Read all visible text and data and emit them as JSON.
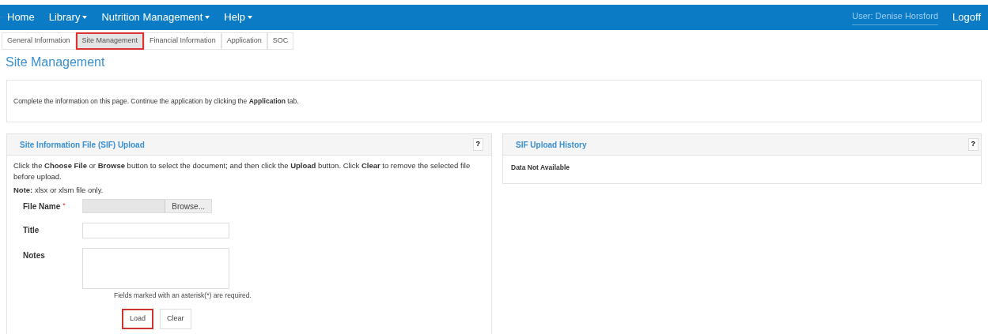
{
  "navbar": {
    "items": [
      {
        "label": "Home",
        "dropdown": false
      },
      {
        "label": "Library",
        "dropdown": true
      },
      {
        "label": "Nutrition Management",
        "dropdown": true
      },
      {
        "label": "Help",
        "dropdown": true
      }
    ],
    "user": "User: Denise Horsford",
    "logoff": "Logoff"
  },
  "tabs": [
    {
      "label": "General Information",
      "selected": false,
      "highlighted": false
    },
    {
      "label": "Site Management",
      "selected": true,
      "highlighted": true
    },
    {
      "label": "Financial Information",
      "selected": false,
      "highlighted": false
    },
    {
      "label": "Application",
      "selected": false,
      "highlighted": false
    },
    {
      "label": "SOC",
      "selected": false,
      "highlighted": false
    }
  ],
  "page_title": "Site Management",
  "info": "Complete the information on this page. Continue the application by clicking the **Application** tab.",
  "upload_panel": {
    "title": "Site Information File (SIF) Upload",
    "help": "?",
    "instructions": "Click the **Choose File** or **Browse** button to select the document; and then click the **Upload** button. Click **Clear** to remove the selected file before upload.",
    "note": "**Note:** xlsx or xlsm file only.",
    "fields": [
      {
        "kind": "file",
        "label": "File Name",
        "required_mark": "*",
        "button": "Browse..."
      },
      {
        "kind": "text",
        "label": "Title"
      },
      {
        "kind": "textarea",
        "label": "Notes"
      }
    ],
    "required_hint": "Fields marked with an asterisk(*) are required.",
    "buttons": [
      {
        "label": "Load",
        "highlighted": true
      },
      {
        "label": "Clear",
        "highlighted": false
      }
    ]
  },
  "history_panel": {
    "title": "SIF Upload History",
    "help": "?",
    "message": "Data Not Available"
  }
}
